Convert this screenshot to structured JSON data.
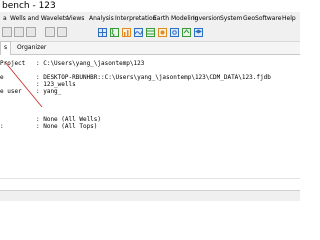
{
  "window": {
    "title": "bench - 123"
  },
  "menubar": {
    "items": [
      "a",
      "Wells and Wavelets",
      "Views",
      "Analysis",
      "Interpretation",
      "Earth Modeling",
      "Inversion",
      "System",
      "GeoSoftware",
      "Help"
    ]
  },
  "tabs": [
    {
      "label": "s",
      "active": true
    },
    {
      "label": "Organizer",
      "active": false
    }
  ],
  "content": {
    "rows": [
      {
        "label": "Project",
        "value": ": C:\\Users\\yang_\\jasontemp\\123"
      },
      {
        "label": "e",
        "value": ": DESKTOP-RBUNHBR::C:\\Users\\yang_\\jasontemp\\123\\CDM_DATA\\123.fjdb"
      },
      {
        "label": "",
        "value": ": 123_wells"
      },
      {
        "label": "e user",
        "value": ": yang_"
      },
      {
        "label": "",
        "value": ""
      },
      {
        "label": "",
        "value": ": None (All Wells)"
      },
      {
        "label": ":",
        "value": ": None (All Tops)"
      }
    ]
  },
  "colors": {
    "annotation_line": "#cc2222",
    "toolbar_blue": "#2f6fc0",
    "toolbar_green": "#3a9a3a",
    "toolbar_orange": "#e08a20"
  }
}
